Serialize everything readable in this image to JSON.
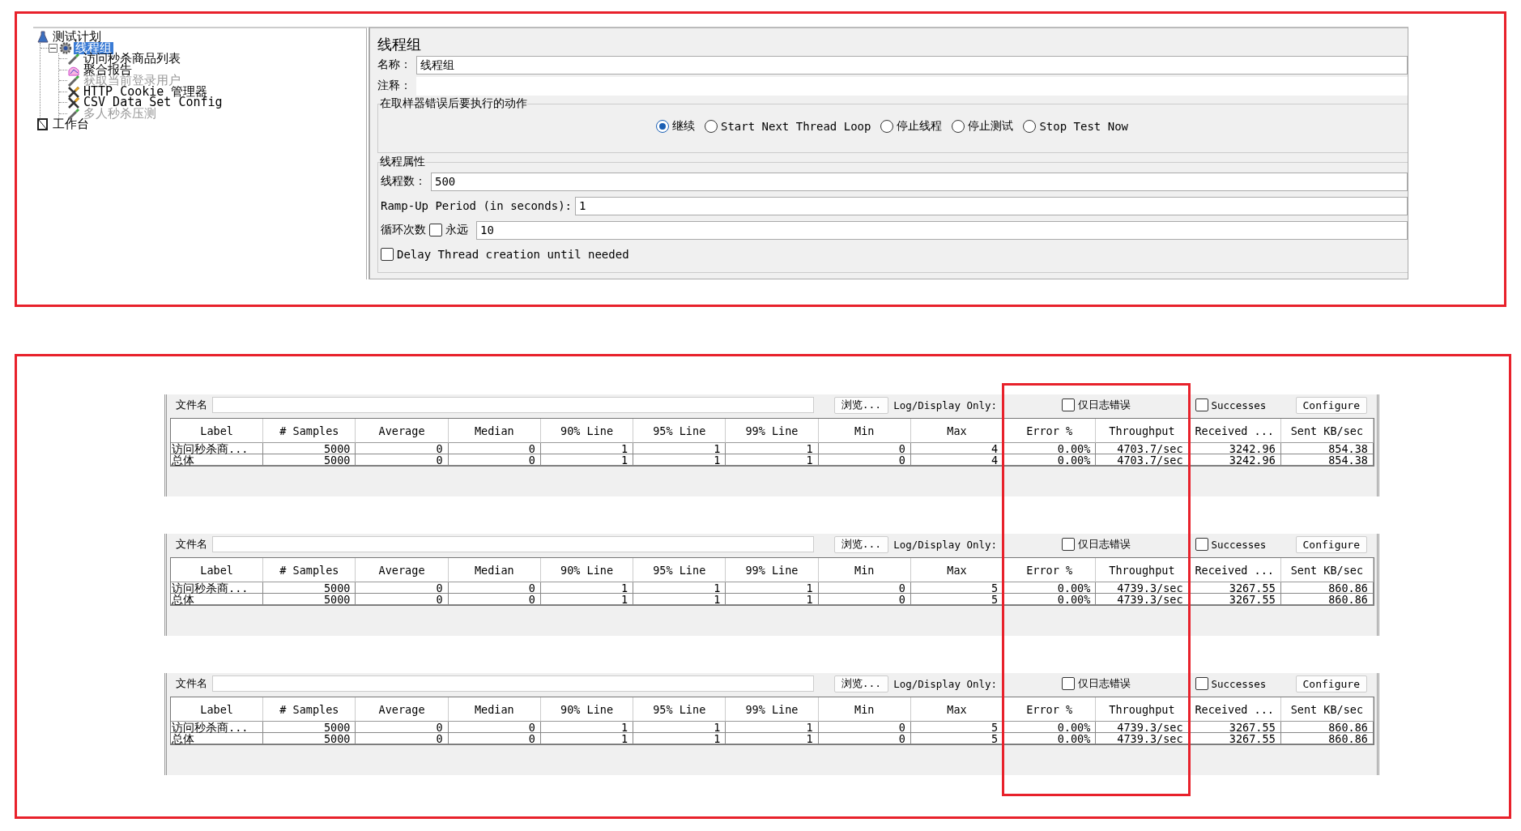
{
  "tree": {
    "items": [
      {
        "label": "测试计划",
        "kind": "plan",
        "selected": false,
        "disabled": false,
        "children": [
          {
            "label": "线程组",
            "kind": "threadgroup",
            "selected": true,
            "disabled": false,
            "expanded": true,
            "children": [
              {
                "label": "访问秒杀商品列表",
                "kind": "sampler",
                "selected": false,
                "disabled": false
              },
              {
                "label": "聚合报告",
                "kind": "listener",
                "selected": false,
                "disabled": false
              },
              {
                "label": "获取当前登录用户",
                "kind": "sampler",
                "selected": false,
                "disabled": true
              },
              {
                "label": "HTTP Cookie 管理器",
                "kind": "config",
                "selected": false,
                "disabled": false
              },
              {
                "label": "CSV Data Set Config",
                "kind": "config",
                "selected": false,
                "disabled": false
              },
              {
                "label": "多人秒杀压测",
                "kind": "sampler",
                "selected": false,
                "disabled": true
              }
            ]
          }
        ]
      },
      {
        "label": "工作台",
        "kind": "workbench",
        "selected": false,
        "disabled": false
      }
    ]
  },
  "thread_group": {
    "title": "线程组",
    "name_label": "名称：",
    "name_value": "线程组",
    "comment_label": "注释：",
    "error_action": {
      "title": "在取样器错误后要执行的动作",
      "options": [
        {
          "label": "继续",
          "selected": true
        },
        {
          "label": "Start Next Thread Loop",
          "selected": false
        },
        {
          "label": "停止线程",
          "selected": false
        },
        {
          "label": "停止测试",
          "selected": false
        },
        {
          "label": "Stop Test Now",
          "selected": false
        }
      ]
    },
    "properties": {
      "title": "线程属性",
      "threads_label": "线程数：",
      "threads_value": "500",
      "rampup_label": "Ramp-Up Period (in seconds):",
      "rampup_value": "1",
      "loop_label": "循环次数",
      "forever": {
        "label": "永远",
        "checked": false
      },
      "loop_value": "10",
      "delay": {
        "label": "Delay Thread creation until needed",
        "checked": false
      }
    }
  },
  "reports": [
    {
      "toolbar": {
        "file_label": "文件名",
        "browse": "浏览...",
        "log_label": "Log/Display Only:",
        "errors": {
          "label": "仅日志错误",
          "checked": false
        },
        "successes": {
          "label": "Successes",
          "checked": false
        },
        "configure": "Configure"
      },
      "columns": [
        "Label",
        "# Samples",
        "Average",
        "Median",
        "90% Line",
        "95% Line",
        "99% Line",
        "Min",
        "Max",
        "Error %",
        "Throughput",
        "Received ...",
        "Sent KB/sec"
      ],
      "rows": [
        [
          "访问秒杀商...",
          "5000",
          "0",
          "0",
          "1",
          "1",
          "1",
          "0",
          "4",
          "0.00%",
          "4703.7/sec",
          "3242.96",
          "854.38"
        ],
        [
          "总体",
          "5000",
          "0",
          "0",
          "1",
          "1",
          "1",
          "0",
          "4",
          "0.00%",
          "4703.7/sec",
          "3242.96",
          "854.38"
        ]
      ]
    },
    {
      "toolbar": {
        "file_label": "文件名",
        "browse": "浏览...",
        "log_label": "Log/Display Only:",
        "errors": {
          "label": "仅日志错误",
          "checked": false
        },
        "successes": {
          "label": "Successes",
          "checked": false
        },
        "configure": "Configure"
      },
      "columns": [
        "Label",
        "# Samples",
        "Average",
        "Median",
        "90% Line",
        "95% Line",
        "99% Line",
        "Min",
        "Max",
        "Error %",
        "Throughput",
        "Received ...",
        "Sent KB/sec"
      ],
      "rows": [
        [
          "访问秒杀商...",
          "5000",
          "0",
          "0",
          "1",
          "1",
          "1",
          "0",
          "5",
          "0.00%",
          "4739.3/sec",
          "3267.55",
          "860.86"
        ],
        [
          "总体",
          "5000",
          "0",
          "0",
          "1",
          "1",
          "1",
          "0",
          "5",
          "0.00%",
          "4739.3/sec",
          "3267.55",
          "860.86"
        ]
      ]
    },
    {
      "toolbar": {
        "file_label": "文件名",
        "browse": "浏览...",
        "log_label": "Log/Display Only:",
        "errors": {
          "label": "仅日志错误",
          "checked": false
        },
        "successes": {
          "label": "Successes",
          "checked": false
        },
        "configure": "Configure"
      },
      "columns": [
        "Label",
        "# Samples",
        "Average",
        "Median",
        "90% Line",
        "95% Line",
        "99% Line",
        "Min",
        "Max",
        "Error %",
        "Throughput",
        "Received ...",
        "Sent KB/sec"
      ],
      "rows": [
        [
          "访问秒杀商...",
          "5000",
          "0",
          "0",
          "1",
          "1",
          "1",
          "0",
          "5",
          "0.00%",
          "4739.3/sec",
          "3267.55",
          "860.86"
        ],
        [
          "总体",
          "5000",
          "0",
          "0",
          "1",
          "1",
          "1",
          "0",
          "5",
          "0.00%",
          "4739.3/sec",
          "3267.55",
          "860.86"
        ]
      ]
    }
  ]
}
